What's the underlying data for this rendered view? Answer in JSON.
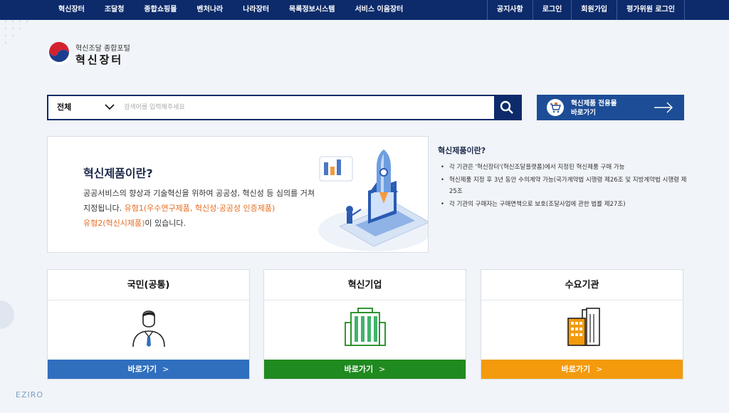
{
  "nav": {
    "main": [
      "혁신장터",
      "조달청",
      "종합쇼핑몰",
      "벤처나라",
      "나라장터",
      "목록정보시스템",
      "서비스 이음장터"
    ],
    "util": [
      "공지사항",
      "로그인",
      "회원가입",
      "평가위원 로그인"
    ]
  },
  "logo": {
    "subtitle": "혁신조달 종합포털",
    "title": "혁신장터"
  },
  "search": {
    "category": "전체",
    "placeholder": "검색어를 입력해주세요"
  },
  "mall_button": {
    "line1": "혁신제품 전용몰",
    "line2": "바로가기"
  },
  "intro": {
    "title": "혁신제품이란?",
    "desc_1": "공공서비스의 향상과 기술혁신을 위하여 공공성, 혁신성 등 심의를 거쳐 지정됩니다. ",
    "desc_hl1": "유형1(우수연구제품, 혁신성·공공성 인증제품)",
    "desc_hl2": "유형2(혁신시제품)",
    "desc_2": "이 있습니다."
  },
  "aside": {
    "title": "혁신제품이란?",
    "items": [
      "각 기관은 '혁신장터'(혁신조달플랫폼)에서 지정된 혁신제품 구매 가능",
      "혁신제품 지정 후 3년 동안 수의계약 가능(국가계약법 시행령 제26조 및 지방계약법 시행령 제25조",
      "각 기관의 구매자는 구매면책으로 보호(조달사업에 관한 법률 제27조)"
    ]
  },
  "cards": [
    {
      "title": "국민(공통)",
      "button": "바로가기",
      "icon": "person-icon",
      "color": "#2f6fbe"
    },
    {
      "title": "혁신기업",
      "button": "바로가기",
      "icon": "company-building-icon",
      "color": "#1f8a1f"
    },
    {
      "title": "수요기관",
      "button": "바로가기",
      "icon": "institution-building-icon",
      "color": "#f39a0d"
    }
  ],
  "colors": {
    "nav_bg": "#0d2b6b",
    "mall_bg": "#1d4d96",
    "highlight": "#e66d1f"
  },
  "watermark": "EZIRO"
}
